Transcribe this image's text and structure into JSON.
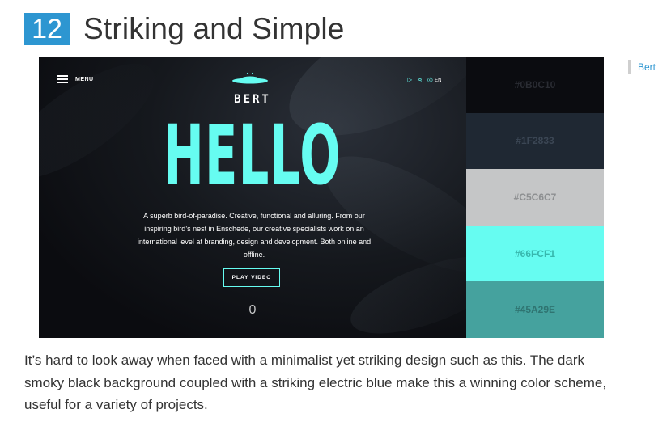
{
  "section": {
    "number": "12",
    "title": "Striking and Simple"
  },
  "preview": {
    "menu_label": "MENU",
    "brand": "BERT",
    "lang": "EN",
    "hero": "HELLO",
    "description": "A superb bird-of-paradise. Creative, functional and alluring. From our inspiring bird’s nest in Enschede, our creative specialists work on an international level at branding, design and development. Both online and offline.",
    "cta": "PLAY VIDEO",
    "counter": "0"
  },
  "palette": [
    {
      "hex": "#0B0C10",
      "color": "#0b0c10",
      "text_color": "#2a2c33"
    },
    {
      "hex": "#1F2833",
      "color": "#1f2833",
      "text_color": "#3b4654"
    },
    {
      "hex": "#C5C6C7",
      "color": "#c5c6c7",
      "text_color": "#8d8f91"
    },
    {
      "hex": "#66FCF1",
      "color": "#66fcf1",
      "text_color": "#37b7ad"
    },
    {
      "hex": "#45A29E",
      "color": "#45a29e",
      "text_color": "#2f7471"
    }
  ],
  "side_tag": "Bert",
  "body": "It’s hard to look away when faced with a minimalist yet striking design such as this. The dark smoky black background coupled with a striking electric blue make this a winning color scheme, useful for a variety of projects.",
  "colors": {
    "accent": "#2d96d1",
    "electric": "#66fcf1"
  }
}
